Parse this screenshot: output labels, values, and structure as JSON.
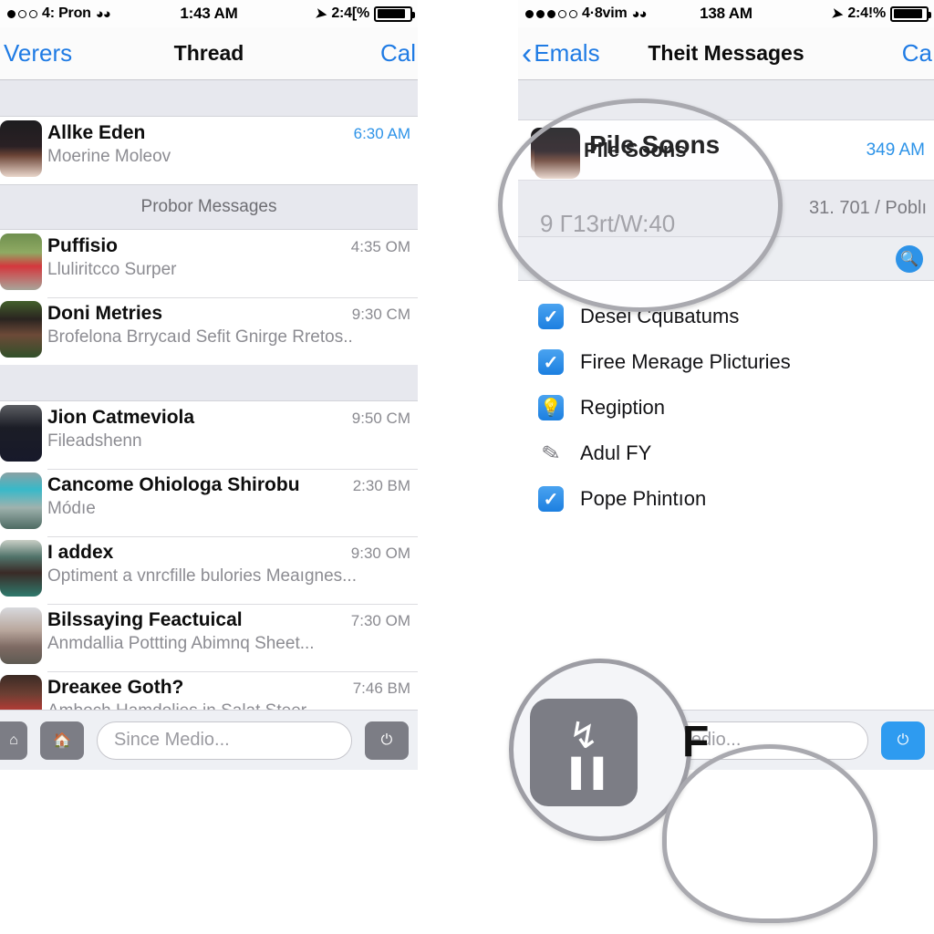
{
  "left": {
    "status": {
      "signal_dots": [
        1,
        0,
        0
      ],
      "carrier": "4: Pron",
      "wifi_icon": "wifi-icon",
      "time": "1:43 AM",
      "location_icon": "location-arrow-icon",
      "battery_text": "2:4[%",
      "battery_icon": "battery-icon"
    },
    "nav": {
      "back_label": "Verers",
      "title": "Thread",
      "right_label": "Cal"
    },
    "section_header": "Probor Messages",
    "rows_top": [
      {
        "name": "Allke Eden",
        "preview": "Moerine Moleov",
        "time": "6:30 AM",
        "time_blue": true,
        "avatar": "av-sky"
      }
    ],
    "rows_mid": [
      {
        "name": "Puffisio",
        "preview": "Lluliritcco Surper",
        "time": "4:35 OM",
        "time_blue": false,
        "avatar": "av-red"
      },
      {
        "name": "Doni Metries",
        "preview": "Brofelona Brrycaıd Sefit Gnirge Rretos..",
        "time": "9:30 CM",
        "time_blue": false,
        "avatar": "av-grn"
      }
    ],
    "rows_bottom": [
      {
        "name": "Jion Catmeviola",
        "preview": "Fileadshenn",
        "time": "9:50 CM",
        "time_blue": false,
        "avatar": "av-nvy"
      },
      {
        "name": "Cancome Ohioloɡa Shirobu",
        "preview": "Módıe",
        "time": "2:30 BM",
        "time_blue": false,
        "avatar": "av-tel"
      },
      {
        "name": "I addex",
        "preview": "Optiment a vnrcfille bulories Meaıgnes...",
        "time": "9:30 OM",
        "time_blue": false,
        "avatar": "av-tea"
      },
      {
        "name": "Bilssaying Feactuical",
        "preview": "Anmdallia Pottting Abimnq Sheet...",
        "time": "7:30 OM",
        "time_blue": false,
        "avatar": "av-cty"
      },
      {
        "name": "Dreaĸеe Goth?",
        "preview": "Amboch Hamdolies in Salat Steer.",
        "time": "7:46 BM",
        "time_blue": false,
        "avatar": "av-mar"
      }
    ],
    "toolbar": {
      "home_icon": "home-icon",
      "house_icon": "house-icon",
      "search_placeholder": "Since Medio...",
      "power_icon": "power-icon"
    }
  },
  "right": {
    "status": {
      "signal_dots": [
        1,
        1,
        1,
        0,
        0
      ],
      "carrier": "4·8vim",
      "wifi_icon": "wifi-icon",
      "time": "138 AM",
      "location_icon": "location-arrow-icon",
      "battery_text": "2:4!%",
      "battery_icon": "battery-icon"
    },
    "nav": {
      "back_label": "Emals",
      "title": "Theit Messages",
      "right_label": "Ca"
    },
    "message_row": {
      "name": "Pile Soons",
      "time": "349 AM",
      "avatar": "av-sky"
    },
    "gray_row_text": "31. 701 / Poblı",
    "search_badge_icon": "search-badge-icon",
    "checklist": [
      {
        "label": "Desei Cquвatums",
        "icon": "checkbox-checked-icon",
        "checked": true
      },
      {
        "label": "Firee Meʀage Plicturies",
        "icon": "checkbox-checked-icon",
        "checked": true
      },
      {
        "label": "Regiption",
        "icon": "lightbulb-icon",
        "checked": false
      },
      {
        "label": "Adul FY",
        "icon": "pencil-icon",
        "checked": false
      },
      {
        "label": "Pope Phintıon",
        "icon": "checkbox-checked-icon",
        "checked": true
      }
    ],
    "toolbar": {
      "search_placeholder": "ibe Medio...",
      "power_icon": "power-icon"
    }
  },
  "magnifiers": {
    "thread_bubble": {
      "name": "Pile Soons",
      "subtext": "9 Γ13rt/W:40"
    },
    "pause_bubble": {
      "icon": "pause-icon",
      "glyph": "↯",
      "bars": "▐▐",
      "letter": "F"
    },
    "search_bubble": {
      "placeholder": "ibe Medio..."
    }
  },
  "colors": {
    "accent_blue": "#2d93e8",
    "nav_blue": "#1f7be4",
    "gray_band": "#e7e8ee",
    "toolbar_gray": "#7c7d85"
  }
}
